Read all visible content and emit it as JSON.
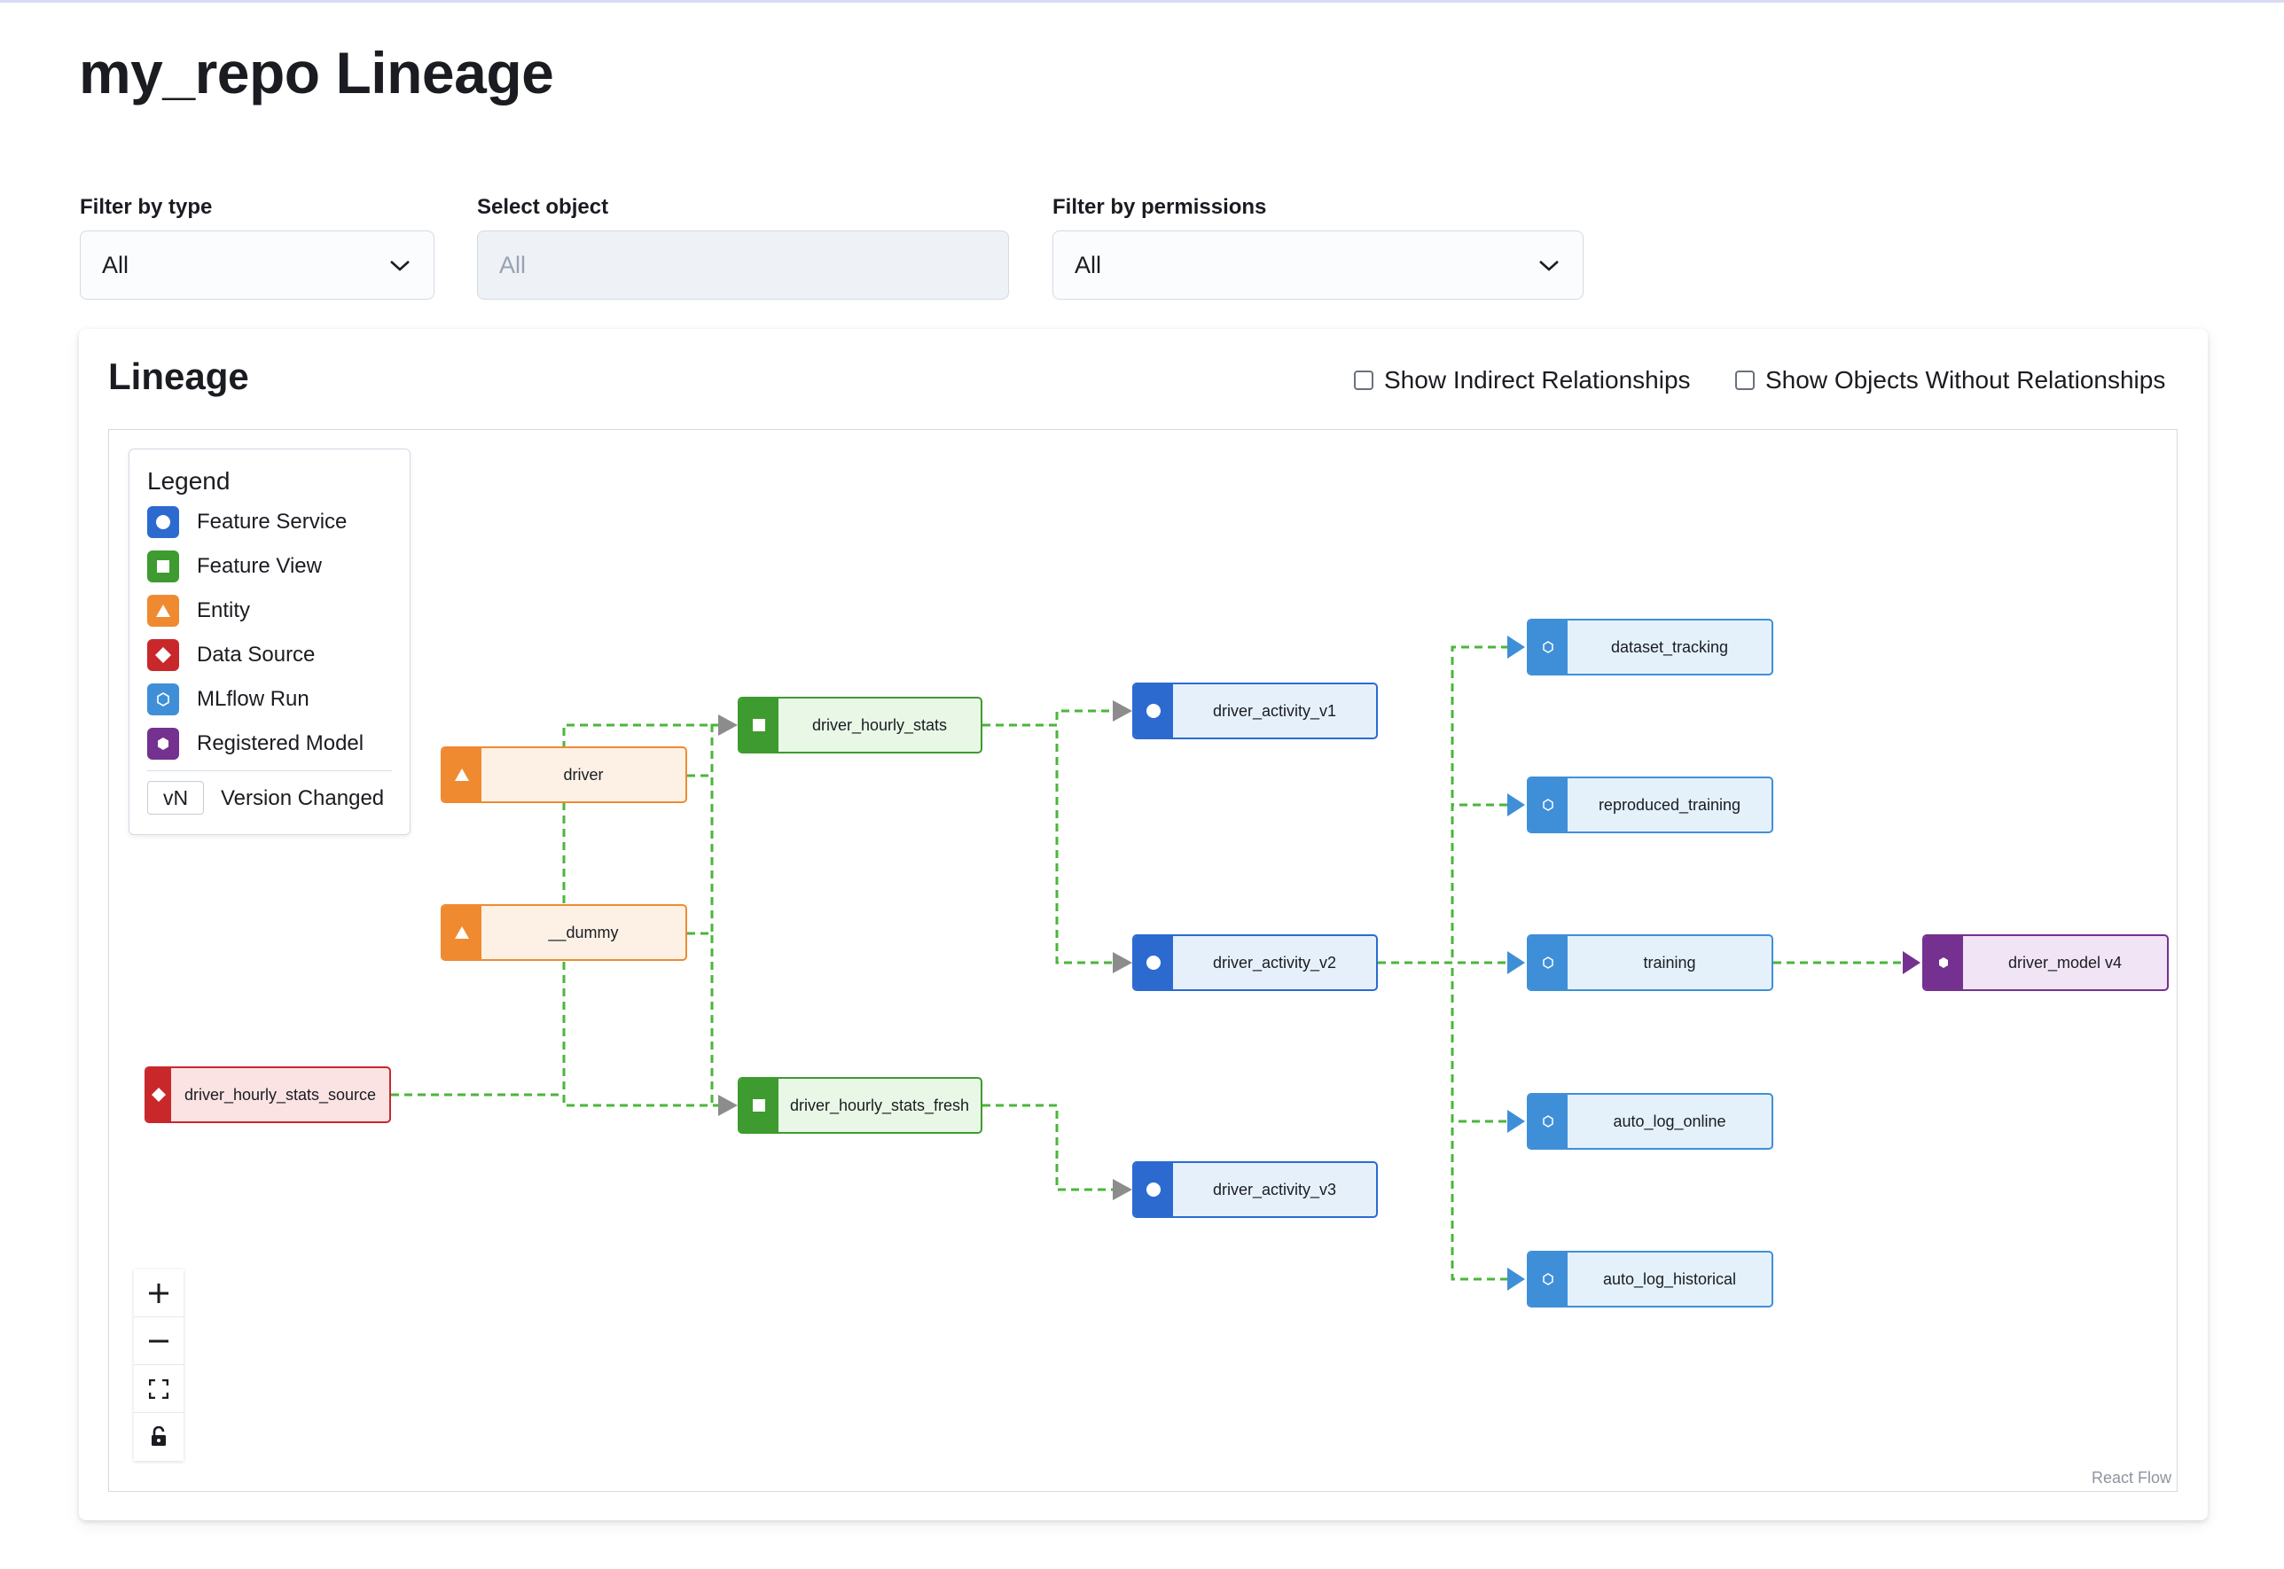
{
  "page": {
    "title": "my_repo Lineage"
  },
  "filters": {
    "type": {
      "label": "Filter by type",
      "value": "All"
    },
    "object": {
      "label": "Select object",
      "placeholder": "All"
    },
    "permissions": {
      "label": "Filter by permissions",
      "value": "All"
    }
  },
  "lineage": {
    "title": "Lineage",
    "show_indirect": "Show Indirect Relationships",
    "show_without": "Show Objects Without Relationships",
    "attribution": "React Flow"
  },
  "legend": {
    "title": "Legend",
    "items": [
      {
        "label": "Feature Service",
        "color": "#2c6ad0",
        "icon": "circle-icon"
      },
      {
        "label": "Feature View",
        "color": "#3e9b2f",
        "icon": "square-icon"
      },
      {
        "label": "Entity",
        "color": "#f08a30",
        "icon": "triangle-icon"
      },
      {
        "label": "Data Source",
        "color": "#c9282a",
        "icon": "diamond-icon"
      },
      {
        "label": "MLflow Run",
        "color": "#3f8fd8",
        "icon": "hexagon-outline-icon"
      },
      {
        "label": "Registered Model",
        "color": "#74318f",
        "icon": "hexagon-icon"
      }
    ],
    "version_badge": "vN",
    "version_label": "Version Changed"
  },
  "nodes": {
    "driver": "driver",
    "dummy": "__dummy",
    "source": "driver_hourly_stats_source",
    "hourly_stats": "driver_hourly_stats",
    "hourly_stats_fresh": "driver_hourly_stats_fresh",
    "activity_v1": "driver_activity_v1",
    "activity_v2": "driver_activity_v2",
    "activity_v3": "driver_activity_v3",
    "dataset_tracking": "dataset_tracking",
    "reproduced_training": "reproduced_training",
    "training": "training",
    "auto_log_online": "auto_log_online",
    "auto_log_historical": "auto_log_historical",
    "driver_model": "driver_model v4"
  },
  "colors": {
    "edge": "#4ab63a",
    "feature_service_bg": "#e6f0fb",
    "feature_view_bg": "#e9f8e6",
    "entity_bg": "#fdf1e6",
    "data_source_bg": "#fbe3e3",
    "mlflow_bg": "#e4f1fb",
    "model_bg": "#f1e4f5"
  },
  "controls": [
    "zoom-in",
    "zoom-out",
    "fit-view",
    "lock"
  ]
}
